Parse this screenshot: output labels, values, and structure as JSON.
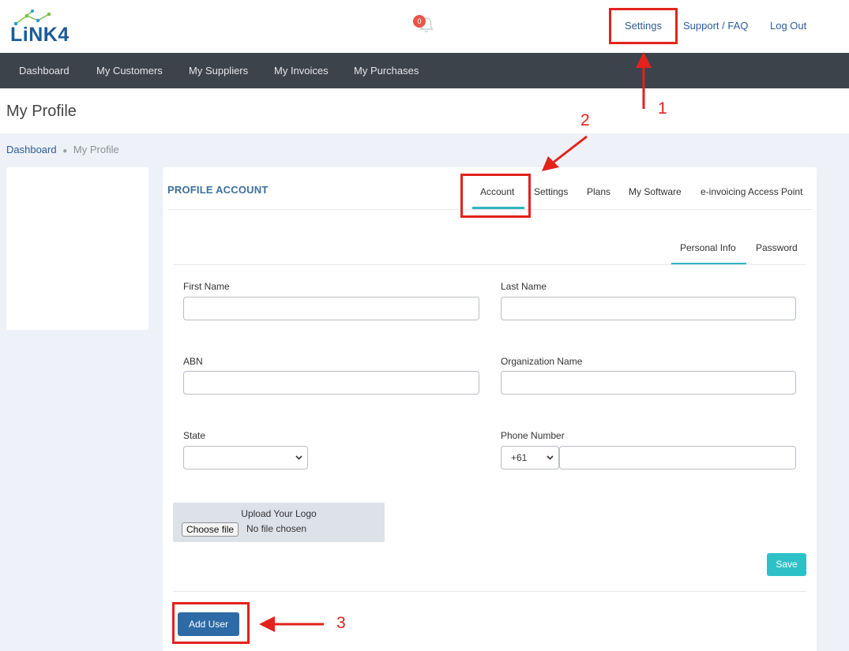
{
  "header": {
    "logo_text": "LiNK4",
    "notification_count": "0",
    "links": {
      "settings": "Settings",
      "support": "Support / FAQ",
      "logout": "Log Out"
    }
  },
  "nav": {
    "items": [
      "Dashboard",
      "My Customers",
      "My Suppliers",
      "My Invoices",
      "My Purchases"
    ]
  },
  "page": {
    "title": "My Profile"
  },
  "breadcrumb": {
    "home": "Dashboard",
    "current": "My Profile"
  },
  "profile": {
    "card_title": "PROFILE ACCOUNT",
    "tabs": [
      "Account",
      "Settings",
      "Plans",
      "My Software",
      "e-invoicing Access Point"
    ],
    "active_tab": "Account",
    "subtabs": [
      "Personal Info",
      "Password"
    ],
    "active_subtab": "Personal Info"
  },
  "form": {
    "first_name_label": "First Name",
    "last_name_label": "Last Name",
    "abn_label": "ABN",
    "org_name_label": "Organization Name",
    "org_name_value": "",
    "state_label": "State",
    "state_value": "",
    "phone_label": "Phone Number",
    "phone_code": "+61",
    "upload_title": "Upload Your Logo",
    "choose_file": "Choose file",
    "no_file": "No file chosen",
    "save_label": "Save",
    "add_user_label": "Add User"
  },
  "annotations": {
    "step1": "1",
    "step2": "2",
    "step3": "3"
  },
  "colors": {
    "accent_teal": "#2ec0c7",
    "primary_blue": "#2d6aa6",
    "nav_bg": "#3d434b",
    "annotation_red": "#e3221c",
    "badge_red": "#e8564b"
  }
}
